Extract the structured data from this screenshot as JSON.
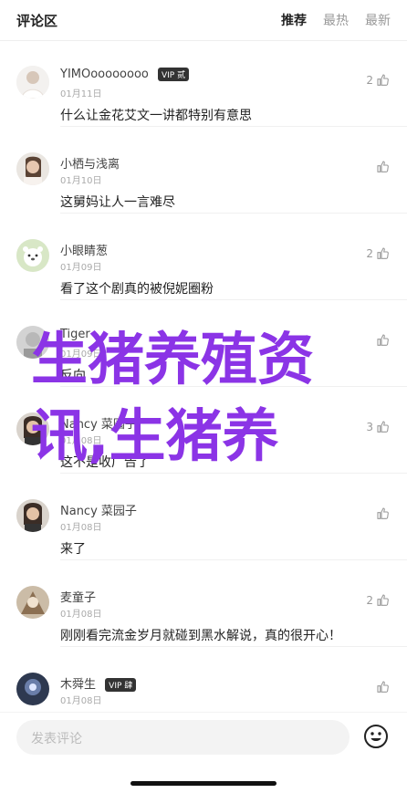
{
  "header": {
    "title": "评论区",
    "tabs": [
      {
        "label": "推荐",
        "active": true
      },
      {
        "label": "最热",
        "active": false
      },
      {
        "label": "最新",
        "active": false
      }
    ]
  },
  "comments": [
    {
      "name": "YIMOoooooooo",
      "badge": "VIP 贰",
      "date": "01月11日",
      "text": "什么让金花艾文一讲都特别有意思",
      "likes": "2",
      "avatar_color": "#f3f1ef"
    },
    {
      "name": "小栖与浅离",
      "badge": "",
      "date": "01月10日",
      "text": "这舅妈让人一言难尽",
      "likes": "",
      "avatar_color": "#8a7a6a"
    },
    {
      "name": "小眼睛葱",
      "badge": "",
      "date": "01月09日",
      "text": "看了这个剧真的被倪妮圈粉",
      "likes": "2",
      "avatar_color": "#d8e7c6"
    },
    {
      "name": "Tiger",
      "badge": "",
      "date": "01月09日",
      "text": "反向",
      "likes": "",
      "avatar_color": "#c9c9c9"
    },
    {
      "name": "Nancy 菜园子",
      "badge": "",
      "date": "01月08日",
      "text": "这不是收广告了",
      "likes": "3",
      "avatar_color": "#6c5646"
    },
    {
      "name": "Nancy 菜园子",
      "badge": "",
      "date": "01月08日",
      "text": "来了",
      "likes": "",
      "avatar_color": "#6c5646"
    },
    {
      "name": "麦童子",
      "badge": "",
      "date": "01月08日",
      "text": "刚刚看完流金岁月就碰到黑水解说，真的很开心！",
      "likes": "2",
      "avatar_color": "#a58f77"
    },
    {
      "name": "木舜生",
      "badge": "VIP 肆",
      "date": "01月08日",
      "text": "",
      "likes": "",
      "avatar_color": "#4b5a78"
    }
  ],
  "overlay": {
    "line1": "生猪养殖资",
    "line2": "讯,生猪养"
  },
  "footer": {
    "placeholder": "发表评论"
  },
  "icons": {
    "like": "thumb-up-icon",
    "emoji": "smiley-icon"
  },
  "colors": {
    "overlay": "#8b34e6"
  }
}
